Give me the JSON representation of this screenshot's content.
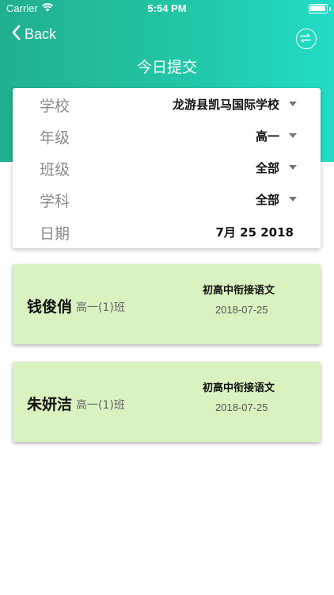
{
  "status_bar": {
    "carrier": "Carrier",
    "time": "5:54 PM"
  },
  "nav": {
    "back_label": "Back",
    "title": "今日提交"
  },
  "filters": {
    "school": {
      "label": "学校",
      "value": "龙游县凯马国际学校"
    },
    "grade": {
      "label": "年级",
      "value": "高一"
    },
    "class": {
      "label": "班级",
      "value": "全部"
    },
    "subject": {
      "label": "学科",
      "value": "全部"
    },
    "date": {
      "label": "日期",
      "value": "7月 25 2018"
    }
  },
  "records": [
    {
      "name": "钱俊俏",
      "class": "高一(1)班",
      "subject": "初高中衔接语文",
      "date": "2018-07-25"
    },
    {
      "name": "朱妍洁",
      "class": "高一(1)班",
      "subject": "初高中衔接语文",
      "date": "2018-07-25"
    }
  ],
  "colors": {
    "header_gradient_start": "#21b08f",
    "header_gradient_end": "#22dcc6",
    "card_green": "#d9f2c0"
  }
}
